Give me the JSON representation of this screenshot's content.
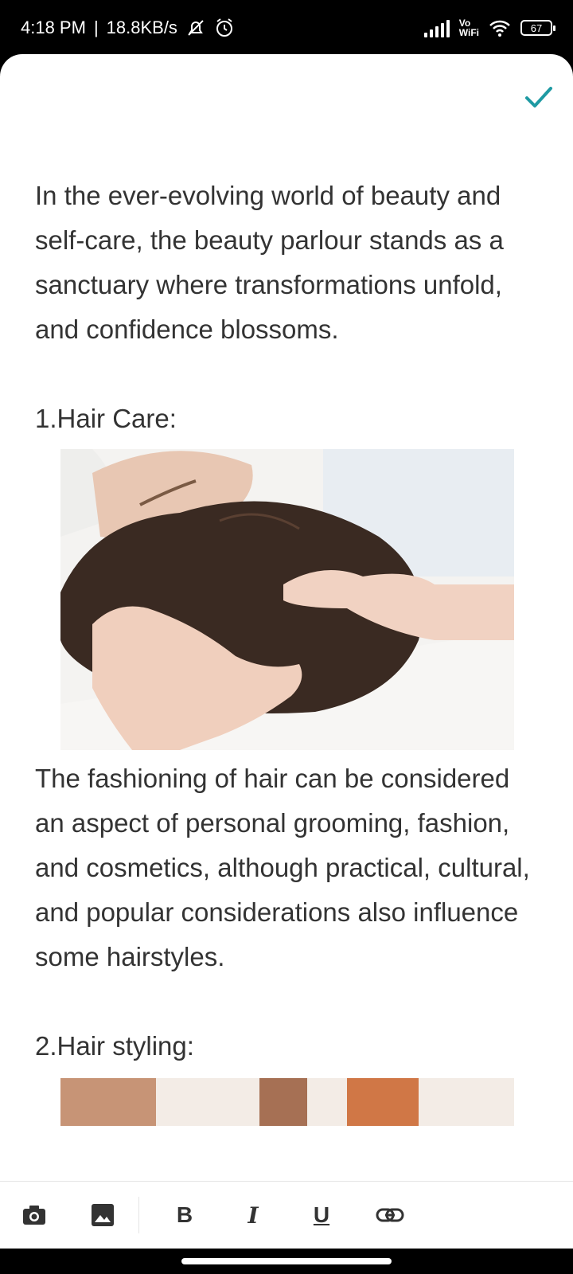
{
  "status": {
    "time": "4:18 PM",
    "sep": "|",
    "speed": "18.8KB/s",
    "vo": "Vo",
    "wifi": "WiFi",
    "battery": "67"
  },
  "content": {
    "intro": "In the ever-evolving world of beauty and self-care, the beauty parlour stands as a sanctuary where transformations unfold, and confidence blossoms.",
    "h1": "1.Hair Care:",
    "p1": "The fashioning of hair can be considered an aspect of personal grooming, fashion, and cosmetics, although practical, cultural, and popular considerations also influence some hairstyles.",
    "h2": "2.Hair styling:"
  },
  "toolbar": {
    "bold": "B",
    "italic": "I",
    "underline": "U"
  },
  "colors": {
    "accent": "#1E9AA3"
  }
}
